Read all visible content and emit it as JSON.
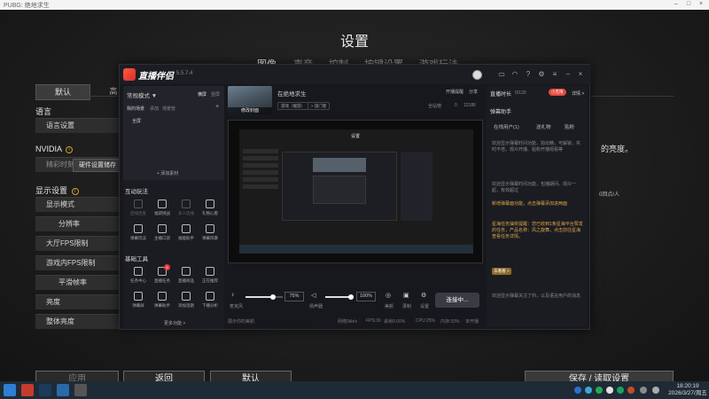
{
  "window": {
    "title": "PUBG: 绝地求生"
  },
  "game": {
    "title": "设置",
    "tabs": [
      "图像",
      "声音",
      "控制",
      "按键设置",
      "游戏玩法"
    ],
    "subtabs": {
      "default": "默认",
      "high": "高"
    },
    "sections": {
      "language": "语言",
      "language_row": "语言设置",
      "nvidia": "NVIDIA",
      "nvidia_row": "精彩时刻",
      "tooltip": "硬件设置储存",
      "display": "显示设置",
      "display_rows": [
        "显示模式",
        "分辨率",
        "大厅FPS限制",
        "游戏内FPS限制",
        "平滑帧率",
        "亮度",
        "整体亮度"
      ]
    },
    "right_text": "的亮度。",
    "right_text2": "0回点/人",
    "bottom": {
      "apply": "应用",
      "back": "返回",
      "default": "默认",
      "save": "保存 / 读取设置"
    }
  },
  "app": {
    "logo": "直播伴侣",
    "version": "5.5.7.4",
    "mode": "常规模式 ▼",
    "mode_a": "横屏",
    "mode_b": "竖屏",
    "scene_tabs": [
      "我的场景",
      "添加",
      "场景管"
    ],
    "scene_item": "全屏",
    "add_material": "+ 添加素材",
    "interactive": "互动玩法",
    "interactive_items": [
      "连线连麦",
      "福袋挑战",
      "多人连线",
      "礼物心愿",
      "弹幕玩法",
      "主播口袋",
      "福能助手",
      "弹幕风暴"
    ],
    "tools": "基础工具",
    "tools_items": [
      "任务中心",
      "直播任务",
      "直播商品",
      "正在推荐",
      "弹幕屏",
      "弹幕助手",
      "添加话题",
      "下播分析"
    ],
    "more": "更多功能 >",
    "stream_title": "在绝地求生",
    "cover_label": "修改封面",
    "tags": [
      "游戏（端游）",
      "> 旅门者"
    ],
    "head_right": [
      "开播提醒",
      "分享"
    ],
    "stats": [
      "全站榜",
      "0",
      "12186"
    ],
    "mini_title": "设置",
    "mic_label": "麦克风",
    "mic_pct": "75%",
    "spk_label": "扬声器",
    "spk_pct": "100%",
    "ctrl_labels": [
      "美颜",
      "录制",
      "设置"
    ],
    "live_btn": "连接中...",
    "status_left": "展示你的美颜",
    "status_items": [
      "网络0kb/s",
      "FPS:30",
      "丢帧0.00%",
      "CPU:25%",
      "内存:33%",
      "未开播"
    ],
    "rp": {
      "title": "直播时长",
      "count": "0/120",
      "badge": "小无限",
      "detail": "详情 >",
      "section": "弹幕助手",
      "tabs": [
        "在线用户(1)",
        "送礼物",
        "贴粉"
      ],
      "messages": [
        "欢迎显示弹幕时间功能，拍出精，可解锁，实时不倍，观众开播、贴粉开播观看等",
        "欢迎显示弹幕时间功能，包播期间，观众一起，有效超过",
        "新增弹幕面功能，点击弹幕添加进两面",
        "星海任务抽奖提醒：您已收到1条星海平台赞发的任务，产品名称：风之旋舞，点击前往星海查看任务详情。",
        "去看看 >",
        "欢迎显示弹幕关注了你，以及语言用户的消息"
      ]
    }
  },
  "taskbar": {
    "time": "18:20:19",
    "date": "2026/3/27/周五"
  },
  "colors": {
    "accent": "#e24a3b",
    "gold": "#c9a52a",
    "highlight": "#e0a84a"
  }
}
